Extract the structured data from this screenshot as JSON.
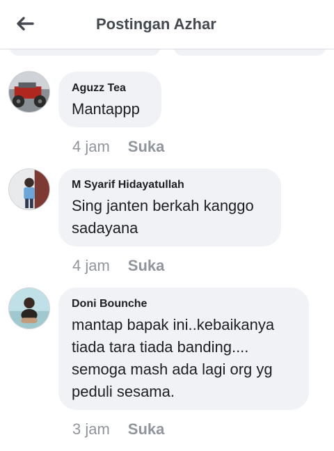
{
  "header": {
    "title": "Postingan Azhar",
    "back_icon": "arrow-left-icon"
  },
  "comments": [
    {
      "author": "Aguzz Tea",
      "text": "Mantappp",
      "time": "4 jam",
      "like_label": "Suka"
    },
    {
      "author": "M Syarif Hidayatullah",
      "text": "Sing janten berkah kanggo\nsadayana",
      "time": "4 jam",
      "like_label": "Suka"
    },
    {
      "author": "Doni Bounche",
      "text": "mantap  bapak ini..kebaikanya\ntiada tara tiada banding....\nsemoga mash ada lagi org yg\npeduli sesama.",
      "time": "3 jam",
      "like_label": "Suka"
    }
  ],
  "colors": {
    "bubble": "#f0f2f5",
    "meta_text": "#90949c",
    "title_text": "#444950"
  }
}
